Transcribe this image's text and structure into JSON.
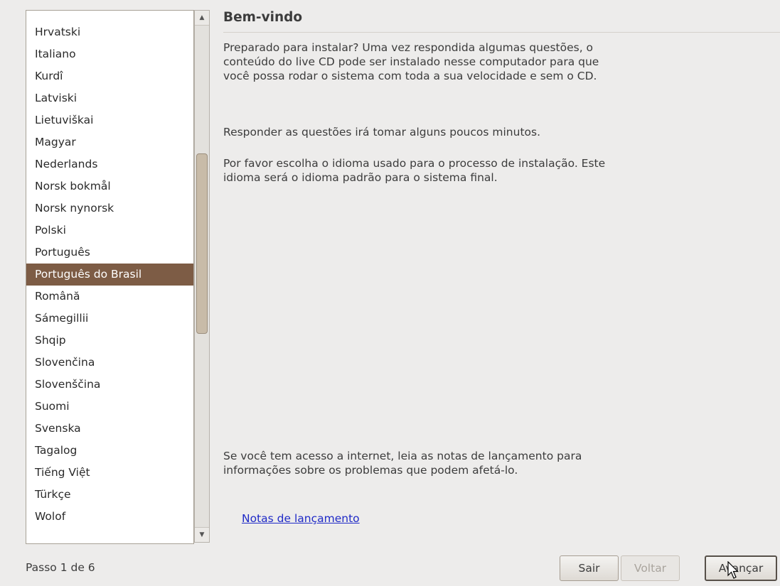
{
  "languages": [
    "Hrvatski",
    "Italiano",
    "Kurdî",
    "Latviski",
    "Lietuviškai",
    "Magyar",
    "Nederlands",
    "Norsk bokmål",
    "Norsk nynorsk",
    "Polski",
    "Português",
    "Português do Brasil",
    "Română",
    "Sámegillii",
    "Shqip",
    "Slovenčina",
    "Slovenščina",
    "Suomi",
    "Svenska",
    "Tagalog",
    "Tiếng Việt",
    "Türkçe",
    "Wolof"
  ],
  "selected_language": "Português do Brasil",
  "main": {
    "title": "Bem-vindo",
    "paragraph1": "Preparado para instalar? Uma vez respondida algumas questões, o conteúdo do live CD pode ser instalado nesse computador para que você possa rodar o sistema com toda a sua velocidade e sem o CD.",
    "paragraph2": "Responder as questões irá tomar alguns poucos minutos.",
    "paragraph3": "Por favor escolha o idioma usado para o processo de instalação. Este idioma será o idioma padrão para o sistema final.",
    "paragraph4": "Se você tem acesso a internet, leia as notas de lançamento para informações sobre os problemas que podem afetá-lo.",
    "release_notes_link": "Notas de lançamento"
  },
  "footer": {
    "step": "Passo 1 de 6",
    "quit_label": "Sair",
    "back_label": "Voltar",
    "next_label": "Avançar"
  },
  "colors": {
    "selection": "#7d5c45",
    "link": "#1f2ac7",
    "background": "#edeceb"
  }
}
